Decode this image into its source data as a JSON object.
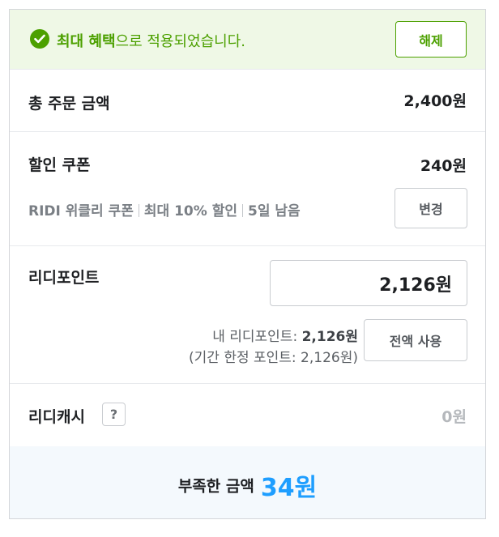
{
  "banner": {
    "highlight": "최대 혜택",
    "text": "으로 적용되었습니다.",
    "cancel_label": "해제"
  },
  "total": {
    "label": "총 주문 금액",
    "value": "2,400원"
  },
  "coupon": {
    "label": "할인 쿠폰",
    "value": "240원",
    "name": "RIDI 위클리 쿠폰",
    "benefit": "최대 10% 할인",
    "remaining": "5일 남음",
    "change_label": "변경"
  },
  "points": {
    "label": "리디포인트",
    "input_value": "2,126원",
    "my_points_label": "내 리디포인트: ",
    "my_points_value": "2,126원",
    "limited_points": "(기간 한정 포인트: 2,126원)",
    "use_all_label": "전액 사용"
  },
  "cash": {
    "label": "리디캐시",
    "help_label": "?",
    "value": "0원"
  },
  "shortage": {
    "label": "부족한 금액",
    "amount": "34원"
  },
  "colors": {
    "accent_green": "#4ca000",
    "accent_blue": "#1e9eff",
    "banner_bg": "#eff8e6",
    "footer_bg": "#f4f9fd"
  },
  "icons": {
    "banner": "check-circle-icon"
  }
}
